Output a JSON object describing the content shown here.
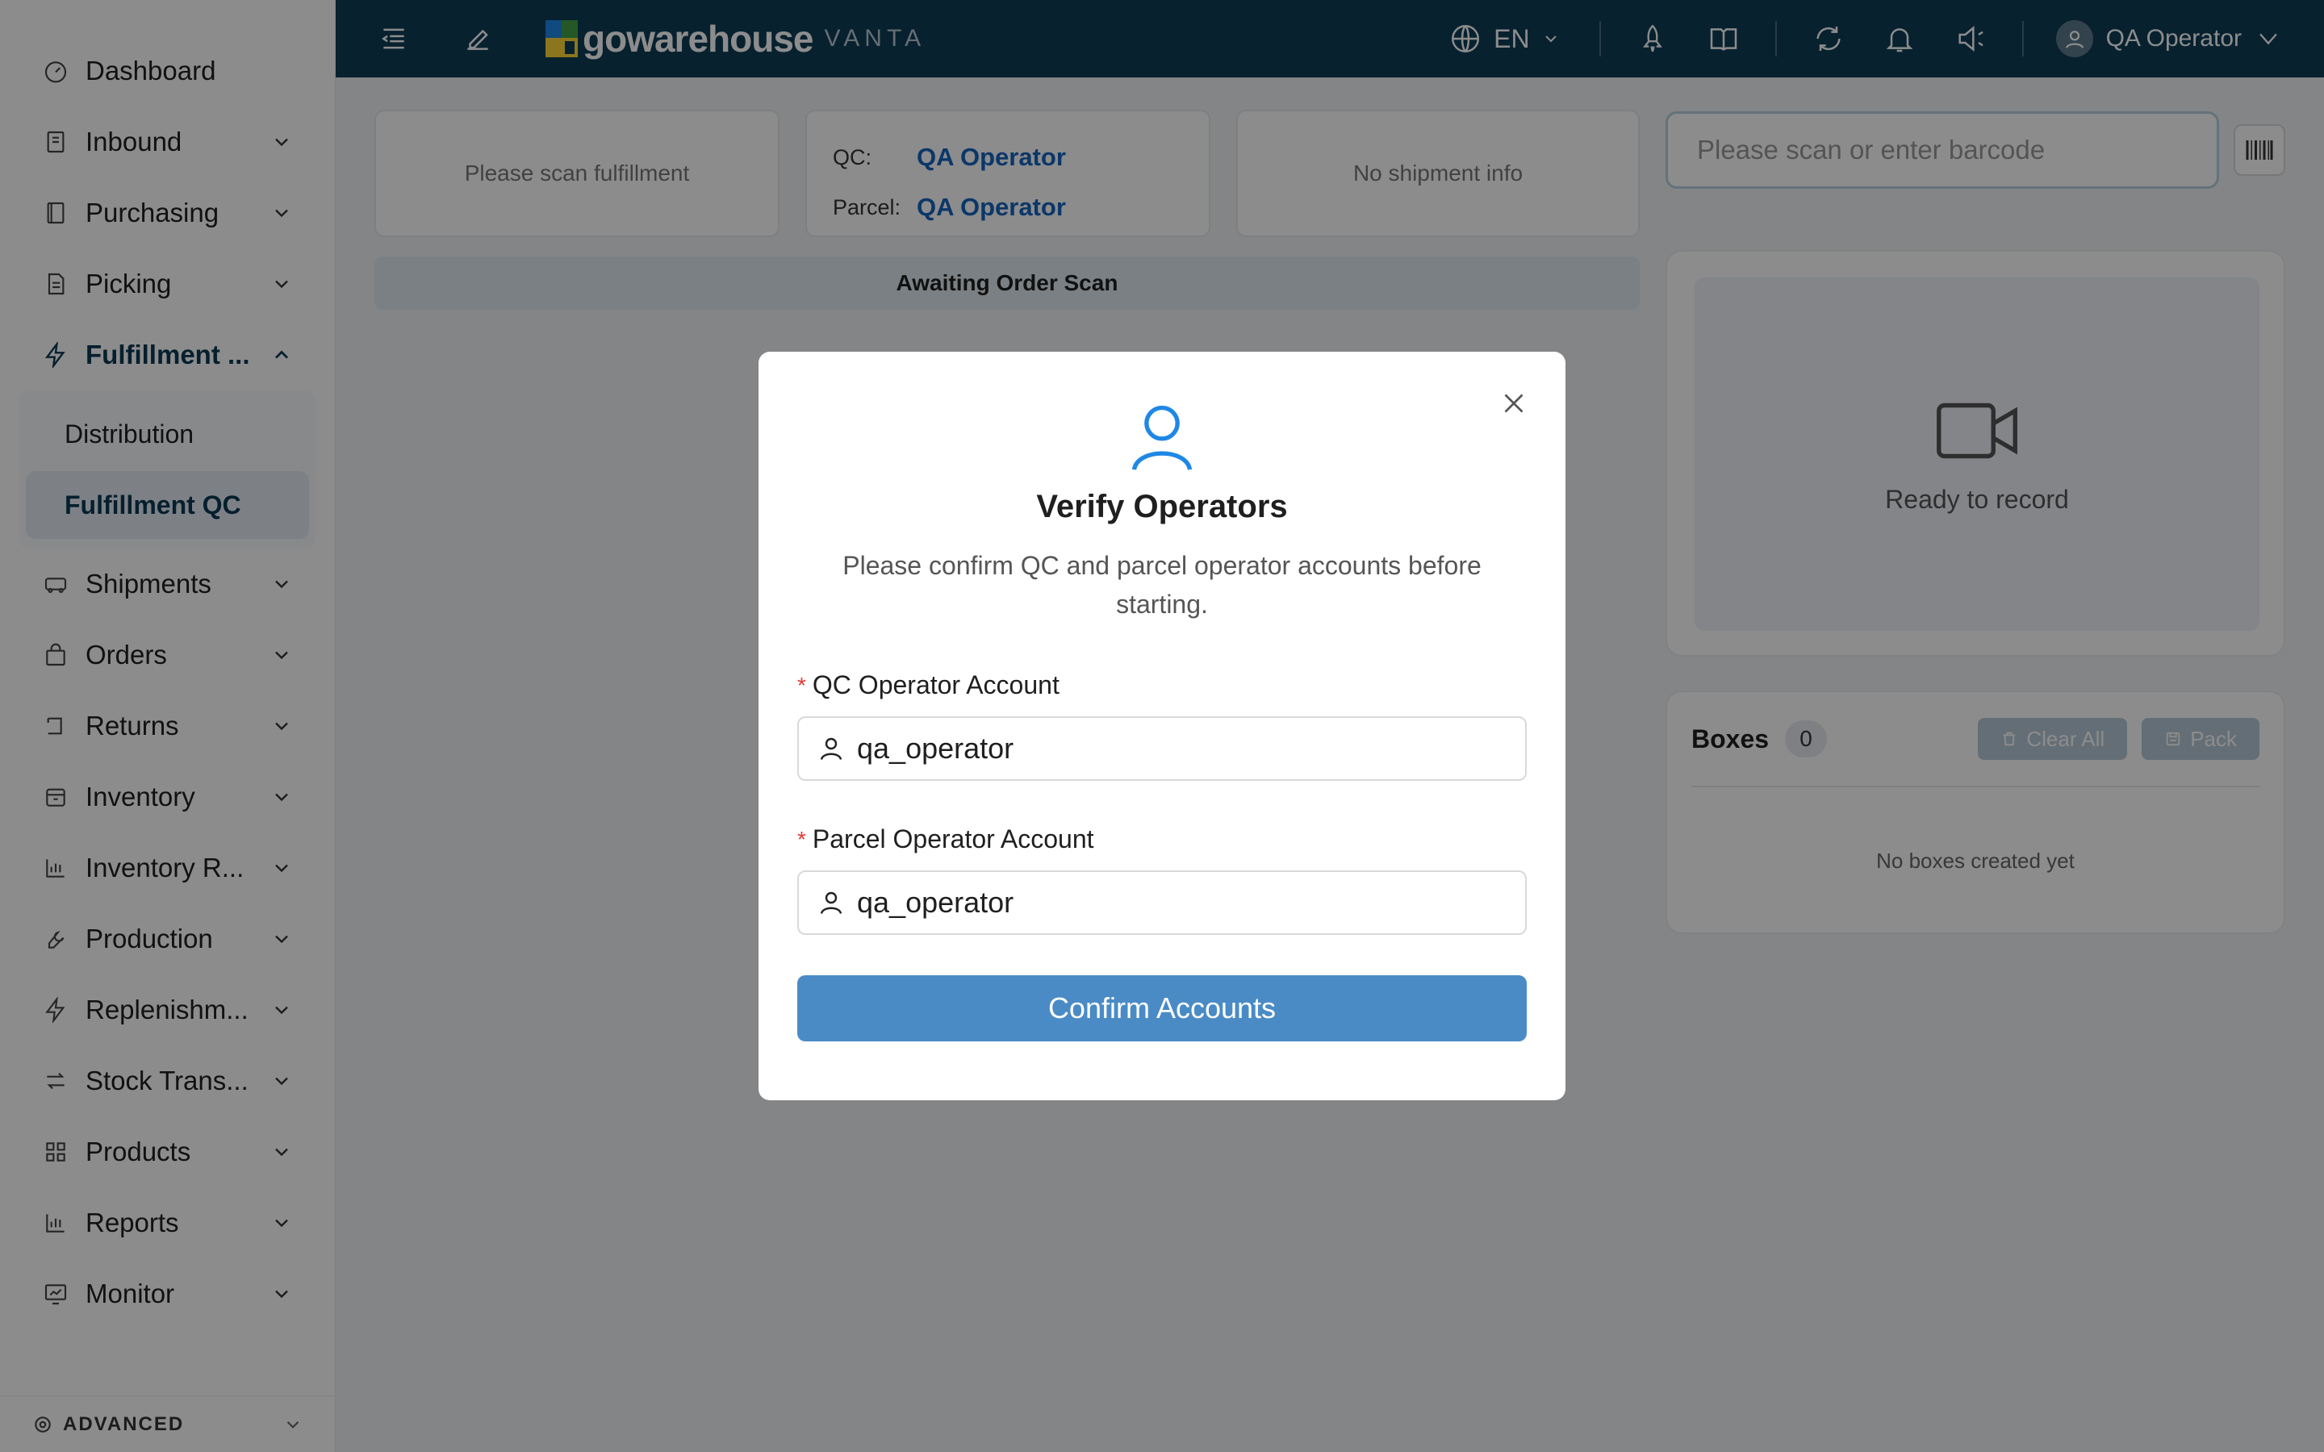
{
  "sidebar": {
    "items": [
      {
        "label": "Dashboard",
        "icon": "dashboard-icon"
      },
      {
        "label": "Inbound",
        "icon": "inbound-icon"
      },
      {
        "label": "Purchasing",
        "icon": "purchasing-icon"
      },
      {
        "label": "Picking",
        "icon": "picking-icon"
      },
      {
        "label": "Fulfillment ...",
        "icon": "lightning-icon"
      },
      {
        "label": "Shipments",
        "icon": "truck-icon"
      },
      {
        "label": "Orders",
        "icon": "bag-icon"
      },
      {
        "label": "Returns",
        "icon": "return-icon"
      },
      {
        "label": "Inventory",
        "icon": "inventory-icon"
      },
      {
        "label": "Inventory R...",
        "icon": "bar-chart-icon"
      },
      {
        "label": "Production",
        "icon": "wrench-icon"
      },
      {
        "label": "Replenishm...",
        "icon": "lightning-icon"
      },
      {
        "label": "Stock Trans...",
        "icon": "transfer-icon"
      },
      {
        "label": "Products",
        "icon": "grid-icon"
      },
      {
        "label": "Reports",
        "icon": "bar-chart-icon"
      },
      {
        "label": "Monitor",
        "icon": "monitor-icon"
      }
    ],
    "sub_items": [
      "Distribution",
      "Fulfillment QC"
    ],
    "advanced_label": "ADVANCED"
  },
  "topbar": {
    "logo_text": "gowarehouse",
    "logo_sub": "VANTA",
    "language": "EN",
    "user_name": "QA Operator"
  },
  "main": {
    "fulfillment_placeholder": "Please scan fulfillment",
    "qc_label": "QC:",
    "qc_value": "QA Operator",
    "parcel_label": "Parcel:",
    "parcel_value": "QA Operator",
    "shipment_info": "No shipment info",
    "status": "Awaiting Order Scan",
    "barcode_placeholder": "Please scan or enter barcode",
    "record_text": "Ready to record",
    "boxes_title": "Boxes",
    "boxes_count": "0",
    "clear_all": "Clear All",
    "pack": "Pack",
    "no_boxes": "No boxes created yet"
  },
  "modal": {
    "title": "Verify Operators",
    "description": "Please confirm QC and parcel operator accounts before starting.",
    "qc_field_label": "QC Operator Account",
    "qc_field_value": "qa_operator",
    "parcel_field_label": "Parcel Operator Account",
    "parcel_field_value": "qa_operator",
    "required_mark": "*",
    "confirm_label": "Confirm Accounts"
  },
  "colors": {
    "topbar": "#0e3d57",
    "accent": "#4a8bc6",
    "link": "#1565c0",
    "required": "#e53935"
  }
}
